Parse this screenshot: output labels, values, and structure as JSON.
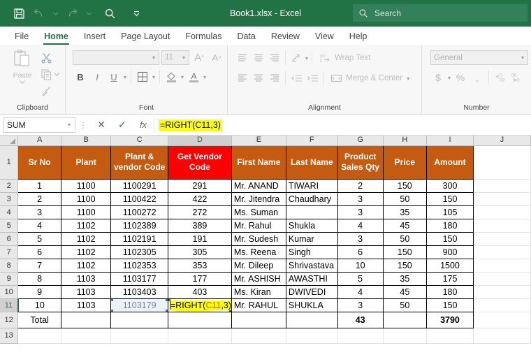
{
  "titlebar": {
    "document_title": "Book1.xlsx  -  Excel",
    "quick_access": [
      {
        "name": "save-icon",
        "label": "Save"
      },
      {
        "name": "undo-icon",
        "label": "Undo"
      },
      {
        "name": "redo-icon",
        "label": "Redo"
      },
      {
        "name": "search-icon",
        "label": "Search"
      },
      {
        "name": "customize-quick-access-icon",
        "label": "Customize Quick Access Toolbar"
      }
    ],
    "search": {
      "placeholder": "Search",
      "icon": "search-icon"
    },
    "colors": {
      "bar": "#217346",
      "search_field": "#33815a"
    }
  },
  "ribbon_tabs": [
    {
      "label": "File"
    },
    {
      "label": "Home"
    },
    {
      "label": "Insert"
    },
    {
      "label": "Page Layout"
    },
    {
      "label": "Formulas"
    },
    {
      "label": "Data"
    },
    {
      "label": "Review"
    },
    {
      "label": "View"
    },
    {
      "label": "Help"
    }
  ],
  "active_tab": "Home",
  "ribbon": {
    "clipboard": {
      "label": "Clipboard",
      "paste_label": "Paste",
      "cut_label": "Cut",
      "copy_label": "Copy",
      "format_painter_label": "Format Painter"
    },
    "font": {
      "label": "Font",
      "font_name_value": "",
      "font_size_value": "11",
      "grow_font_label": "A",
      "shrink_font_label": "A",
      "bold_label": "B",
      "italic_label": "I",
      "underline_label": "U",
      "borders_label": "Borders",
      "fill_color_label": "Fill Color",
      "font_color_label": "A"
    },
    "alignment": {
      "label": "Alignment",
      "wrap_text_label": "Wrap Text",
      "merge_center_label": "Merge & Center"
    },
    "number": {
      "label": "Number",
      "format_value": "General",
      "currency_label": "$",
      "percent_label": "%",
      "comma_label": ",",
      "increase_decimal_label": ".00",
      "decrease_decimal_label": ".00"
    }
  },
  "formula_bar": {
    "name_box_value": "SUM",
    "cancel_label": "✕",
    "enter_label": "✓",
    "insert_function_label": "fx",
    "formula_value": "=RIGHT(C11,3)"
  },
  "sheet": {
    "column_headers": [
      "A",
      "B",
      "C",
      "D",
      "E",
      "F",
      "G",
      "H",
      "I",
      "J"
    ],
    "active_column": "D",
    "active_row": "11",
    "row_numbers": [
      "1",
      "2",
      "3",
      "4",
      "5",
      "6",
      "7",
      "8",
      "9",
      "10",
      "11",
      "12",
      "13"
    ],
    "table_headers": [
      "Sr No",
      "Plant",
      "Plant & vendor Code",
      "Get Vendor Code",
      "First Name",
      "Last Name",
      "Product Sales Qty",
      "Price",
      "Amount"
    ],
    "header_colors": {
      "default": "#c55a11",
      "highlight": "#ff0000",
      "text": "#ffffff"
    },
    "rows": [
      {
        "sr": "1",
        "plant": "1100",
        "code": "1100291",
        "vendor": "291",
        "first": "Mr. ANAND",
        "last": "TIWARI",
        "qty": "2",
        "price": "150",
        "amount": "300"
      },
      {
        "sr": "2",
        "plant": "1100",
        "code": "1100422",
        "vendor": "422",
        "first": "Mr. Jitendra",
        "last": "Chaudhary",
        "qty": "3",
        "price": "50",
        "amount": "150"
      },
      {
        "sr": "3",
        "plant": "1100",
        "code": "1100272",
        "vendor": "272",
        "first": "Ms. Suman",
        "last": "",
        "qty": "3",
        "price": "35",
        "amount": "105"
      },
      {
        "sr": "4",
        "plant": "1102",
        "code": "1102389",
        "vendor": "389",
        "first": "Mr. Rahul",
        "last": "Shukla",
        "qty": "4",
        "price": "45",
        "amount": "180"
      },
      {
        "sr": "5",
        "plant": "1102",
        "code": "1102191",
        "vendor": "191",
        "first": "Mr. Sudesh",
        "last": "Kumar",
        "qty": "3",
        "price": "50",
        "amount": "150"
      },
      {
        "sr": "6",
        "plant": "1102",
        "code": "1102305",
        "vendor": "305",
        "first": "Ms. Reena",
        "last": "Singh",
        "qty": "6",
        "price": "150",
        "amount": "900"
      },
      {
        "sr": "7",
        "plant": "1102",
        "code": "1102353",
        "vendor": "353",
        "first": "Mr. Dileep",
        "last": "Shrivastava",
        "qty": "10",
        "price": "150",
        "amount": "1500"
      },
      {
        "sr": "8",
        "plant": "1103",
        "code": "1103177",
        "vendor": "177",
        "first": "Mr. ASHISH",
        "last": "AWASTHI",
        "qty": "5",
        "price": "35",
        "amount": "175"
      },
      {
        "sr": "9",
        "plant": "1103",
        "code": "1103403",
        "vendor": "403",
        "first": "Ms. Kiran",
        "last": "DWIVEDI",
        "qty": "4",
        "price": "45",
        "amount": "180"
      }
    ],
    "editing_row": {
      "sr": "10",
      "plant": "1103",
      "code": "1103179",
      "formula_prefix": "=RIGHT(",
      "formula_ref": "C11",
      "formula_suffix": ",3)",
      "first": "Mr. RAHUL",
      "last": "SHUKLA",
      "qty": "3",
      "price": "50",
      "amount": "150"
    },
    "total_row": {
      "label": "Total",
      "qty": "43",
      "amount": "3790"
    }
  }
}
